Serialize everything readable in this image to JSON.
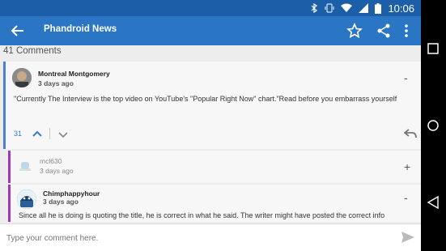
{
  "status_bar": {
    "time": "10:06"
  },
  "app_bar": {
    "title": "Phandroid News"
  },
  "comments": {
    "count_label": "41 Comments",
    "items": [
      {
        "author": "Montreal Montgomery",
        "time": "3 days ago",
        "text": "\"Currently The Interview is the top video on YouTube's \"Popular Right Now\" chart.\"Read before you embarrass yourself",
        "votes": "31",
        "collapse": "-"
      },
      {
        "author": "mcl630",
        "time": "3 days ago",
        "collapse": "+"
      },
      {
        "author": "Chimphappyhour",
        "time": "3 days ago",
        "text": "Since all he is doing is quoting the title, he is correct in what he said. The writer might have posted the correct info",
        "collapse": "-"
      }
    ]
  },
  "composer": {
    "placeholder": "Type your comment here."
  },
  "colors": {
    "appbar": "#2a76c4",
    "statusbar": "#1c5fa8",
    "thread_primary": "#4a7fd4",
    "thread_reply": "#9a38b6"
  }
}
